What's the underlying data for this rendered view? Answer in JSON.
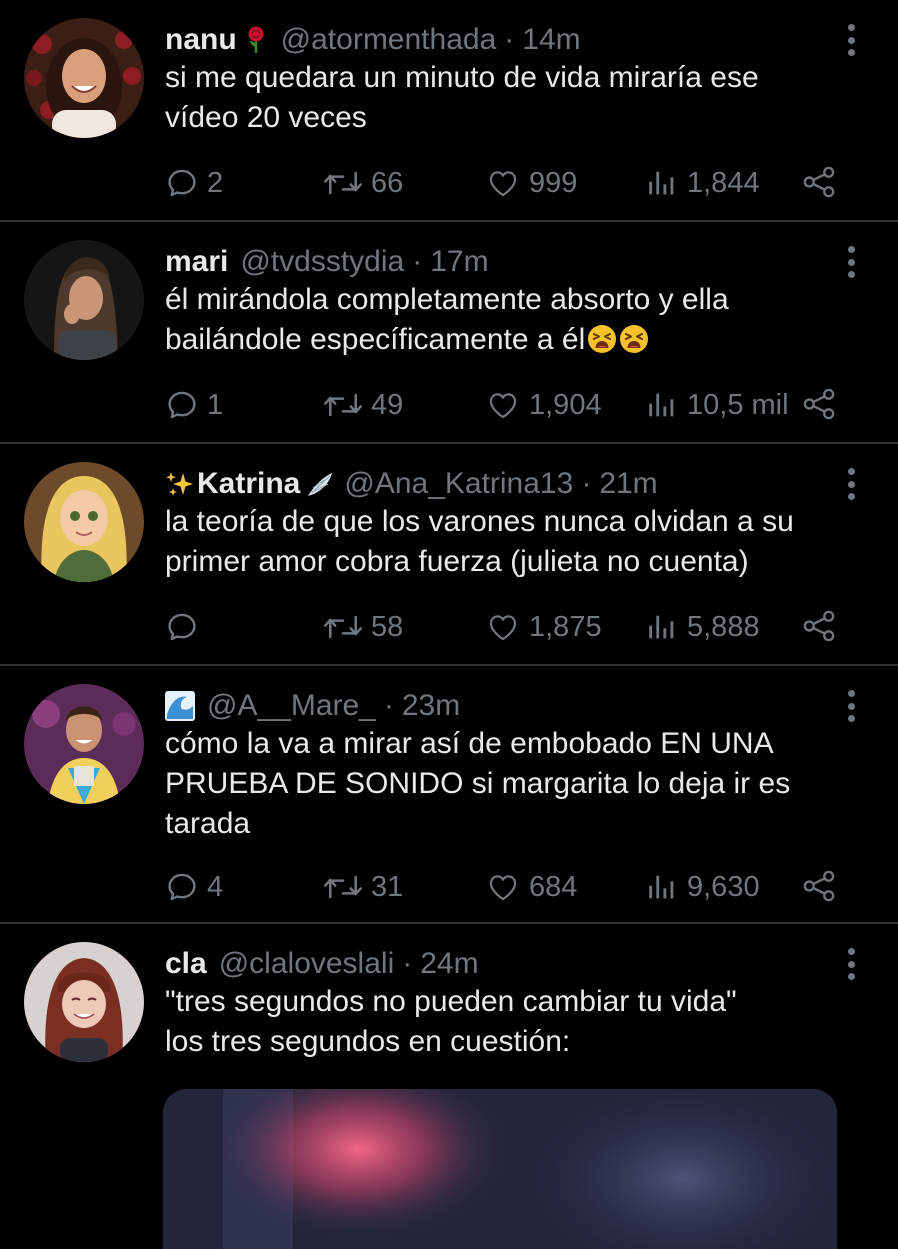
{
  "tweets": [
    {
      "name": "nanu",
      "handle": "@atormenthada",
      "time": "14m",
      "text": "si me quedara un minuto de vida miraría ese\nvídeo 20 veces",
      "replies": "2",
      "retweets": "66",
      "likes": "999",
      "views": "1,844",
      "badge_icon": "rose-emoji"
    },
    {
      "name": "mari",
      "handle": "@tvdsstydia",
      "time": "17m",
      "text": "él mirándola completamente absorto y ella\nbailándole específicamente a él",
      "text_emojis": [
        "tired-face-emoji",
        "tired-face-emoji"
      ],
      "replies": "1",
      "retweets": "49",
      "likes": "1,904",
      "views": "10,5 mil"
    },
    {
      "name": "Katrina",
      "handle": "@Ana_Katrina13",
      "time": "21m",
      "text": "la teoría de que los varones nunca olvidan a su\nprimer amor cobra fuerza (julieta no cuenta)",
      "replies": "",
      "retweets": "58",
      "likes": "1,875",
      "views": "5,888",
      "name_icons": [
        "sparkles-emoji",
        "wing-emoji"
      ]
    },
    {
      "name": "",
      "handle": "@A__Mare_",
      "time": "23m",
      "text": "cómo la va a mirar así de embobado EN UNA\nPRUEBA DE SONIDO si margarita lo deja ir es\ntarada",
      "replies": "4",
      "retweets": "31",
      "likes": "684",
      "views": "9,630",
      "name_icons": [
        "wave-emoji"
      ]
    },
    {
      "name": "cla",
      "handle": "@claloveslali",
      "time": "24m",
      "text": "\"tres segundos no pueden cambiar tu vida\"\nlos tres segundos en cuestión:",
      "media": "video-thumbnail"
    }
  ],
  "separator": "·",
  "colors": {
    "background": "#000000",
    "text": "#e7e9ea",
    "muted": "#71767b",
    "divider": "#2f3336"
  },
  "icons": [
    "reply-icon",
    "retweet-icon",
    "like-icon",
    "views-icon",
    "share-icon",
    "more-options-icon"
  ]
}
